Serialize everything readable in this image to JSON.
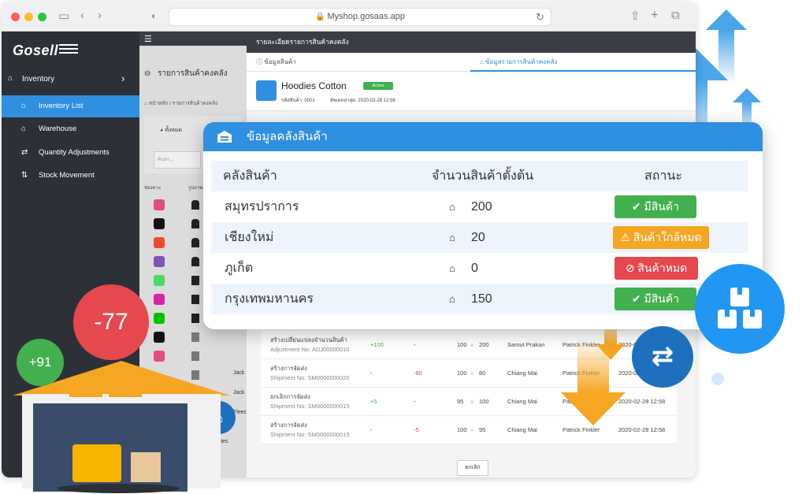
{
  "browser": {
    "url": "Myshop.gosaas.app"
  },
  "sidebar": {
    "logo": "Gosell",
    "section": "Inventory",
    "items": [
      {
        "label": "Inventory List",
        "icon": "warehouse-icon"
      },
      {
        "label": "Warehouse",
        "icon": "warehouse-icon"
      },
      {
        "label": "Quantity Adjustments",
        "icon": "transfer-icon"
      },
      {
        "label": "Stock Movement",
        "icon": "sort-icon"
      }
    ]
  },
  "midpanel": {
    "title": "รายการสินค้าคงคลัง",
    "breadcrumb_home": "หน้าหลัก",
    "breadcrumb_current": "รายการสินค้าคงคลัง",
    "filter_all": "ทั้งหมด",
    "search_placeholder": "ค้นหา...",
    "col_channel": "ช่องทาง",
    "col_image": "รูปภาพ",
    "rows": [
      {
        "name": ""
      },
      {
        "name": ""
      },
      {
        "name": ""
      },
      {
        "name": ""
      },
      {
        "name": ""
      },
      {
        "name": ""
      },
      {
        "name": ""
      },
      {
        "name": ""
      },
      {
        "name": "Jack"
      },
      {
        "name": "Jack"
      },
      {
        "name": "Fleec"
      }
    ],
    "entries_text": "of 15 entries"
  },
  "rightpanel": {
    "header": "รายละเอียดรายการสินค้าคงคลัง",
    "tab_product": "ข้อมูลสินค้า",
    "tab_inventory": "ข้อมูลรายการสินค้าคงคลัง",
    "product_name": "Hoodies Cotton",
    "product_status": "Active",
    "product_code": "รหัสสินค้า: 0001",
    "product_updated": "อัพเดทล่าสุด: 2020-02-28 12:58",
    "cancel_button": "ยกเลิก",
    "movements": [
      {
        "type": "สร้างเปลี่ยนแปลงจำนวนสินค้า",
        "ref": "Adjustment No: ADJ00000010",
        "in": "+100",
        "out": "-",
        "from": "100",
        "to": "200",
        "branch": "Samut Prakan",
        "user": "Patrick Finkler",
        "date": "2020-02-28 12:58"
      },
      {
        "type": "สร้างการจัดส่ง",
        "ref": "Shipment No: SM0000000020",
        "in": "-",
        "out": "-80",
        "from": "100",
        "to": "80",
        "branch": "Chiang Mai",
        "user": "Patrick Finkler",
        "date": "2020-02-28 12:58"
      },
      {
        "type": "ยกเลิกการจัดส่ง",
        "ref": "Shipment No: SM0000000015",
        "in": "+5",
        "out": "-",
        "from": "95",
        "to": "100",
        "branch": "Chiang Mai",
        "user": "Patrick Finkler",
        "date": "2020-02-28 12:58"
      },
      {
        "type": "สร้างการจัดส่ง",
        "ref": "Shipment No: SM0000000015",
        "in": "-",
        "out": "-5",
        "from": "100",
        "to": "95",
        "branch": "Chiang Mai",
        "user": "Patrick Finkler",
        "date": "2020-02-28 12:58"
      }
    ]
  },
  "card": {
    "title": "ข้อมูลคลังสินค้า",
    "col_warehouse": "คลังสินค้า",
    "col_qty": "จำนวนสินค้าตั้งต้น",
    "col_status": "สถานะ",
    "rows": [
      {
        "warehouse": "สมุทรปราการ",
        "qty": "200",
        "status": "มีสินค้า",
        "tone": "green"
      },
      {
        "warehouse": "เชียงใหม่",
        "qty": "20",
        "status": "สินค้าใกล้หมด",
        "tone": "orange"
      },
      {
        "warehouse": "ภูเก็ต",
        "qty": "0",
        "status": "สินค้าหมด",
        "tone": "red"
      },
      {
        "warehouse": "กรุงเทพมหานคร",
        "qty": "150",
        "status": "มีสินค้า",
        "tone": "green"
      }
    ]
  },
  "bubbles": {
    "plus": "+91",
    "minus": "-77"
  },
  "colors": {
    "primary": "#2f8fe0",
    "green": "#42b04e",
    "orange": "#f5a623",
    "red": "#e5484d",
    "sidebar": "#2e3037"
  }
}
